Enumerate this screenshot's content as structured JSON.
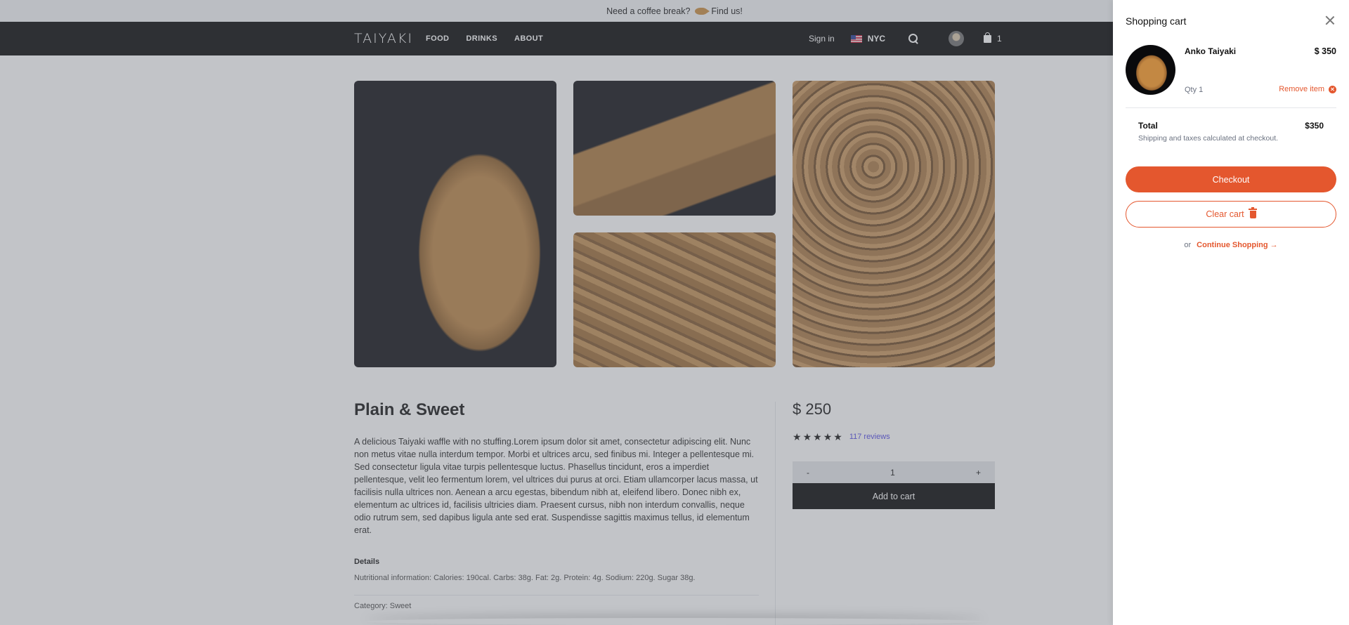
{
  "announcement": {
    "text": "Need a coffee break?",
    "link": "Find us!"
  },
  "nav": {
    "logo": "TAIYAKI",
    "links": [
      "FOOD",
      "DRINKS",
      "ABOUT"
    ],
    "sign_in": "Sign in",
    "region": "NYC",
    "cart_count": "1"
  },
  "product": {
    "title": "Plain & Sweet",
    "description": "A delicious Taiyaki waffle with no stuffing.Lorem ipsum dolor sit amet, consectetur adipiscing elit. Nunc non metus vitae nulla interdum tempor. Morbi et ultrices arcu, sed finibus mi. Integer a pellentesque mi. Sed consectetur ligula vitae turpis pellentesque luctus. Phasellus tincidunt, eros a imperdiet pellentesque, velit leo fermentum lorem, vel ultrices dui purus at orci. Etiam ullamcorper lacus massa, ut facilisis nulla ultrices non. Aenean a arcu egestas, bibendum nibh at, eleifend libero. Donec nibh ex, elementum ac ultrices id, facilisis ultricies diam. Praesent cursus, nibh non interdum convallis, neque odio rutrum sem, sed dapibus ligula ante sed erat. Suspendisse sagittis maximus tellus, id elementum erat.",
    "details_heading": "Details",
    "details_text": "Nutritional information: Calories: 190cal. Carbs: 38g. Fat: 2g. Protein: 4g. Sodium: 220g. Sugar 38g.",
    "category": "Category: Sweet",
    "price": "$ 250",
    "rating": 5,
    "reviews": "117 reviews",
    "qty_minus": "-",
    "qty_value": "1",
    "qty_plus": "+",
    "add_to_cart": "Add to cart"
  },
  "cart": {
    "title": "Shopping cart",
    "item": {
      "name": "Anko Taiyaki",
      "price": "$ 350",
      "qty": "Qty 1",
      "remove": "Remove item"
    },
    "total_label": "Total",
    "total_value": "$350",
    "shipping_note": "Shipping and taxes calculated at checkout.",
    "checkout": "Checkout",
    "clear": "Clear cart",
    "or": "or",
    "continue": "Continue Shopping"
  },
  "colors": {
    "accent": "#e4572e",
    "link": "#4f46e5",
    "nav_bg": "#000000"
  }
}
